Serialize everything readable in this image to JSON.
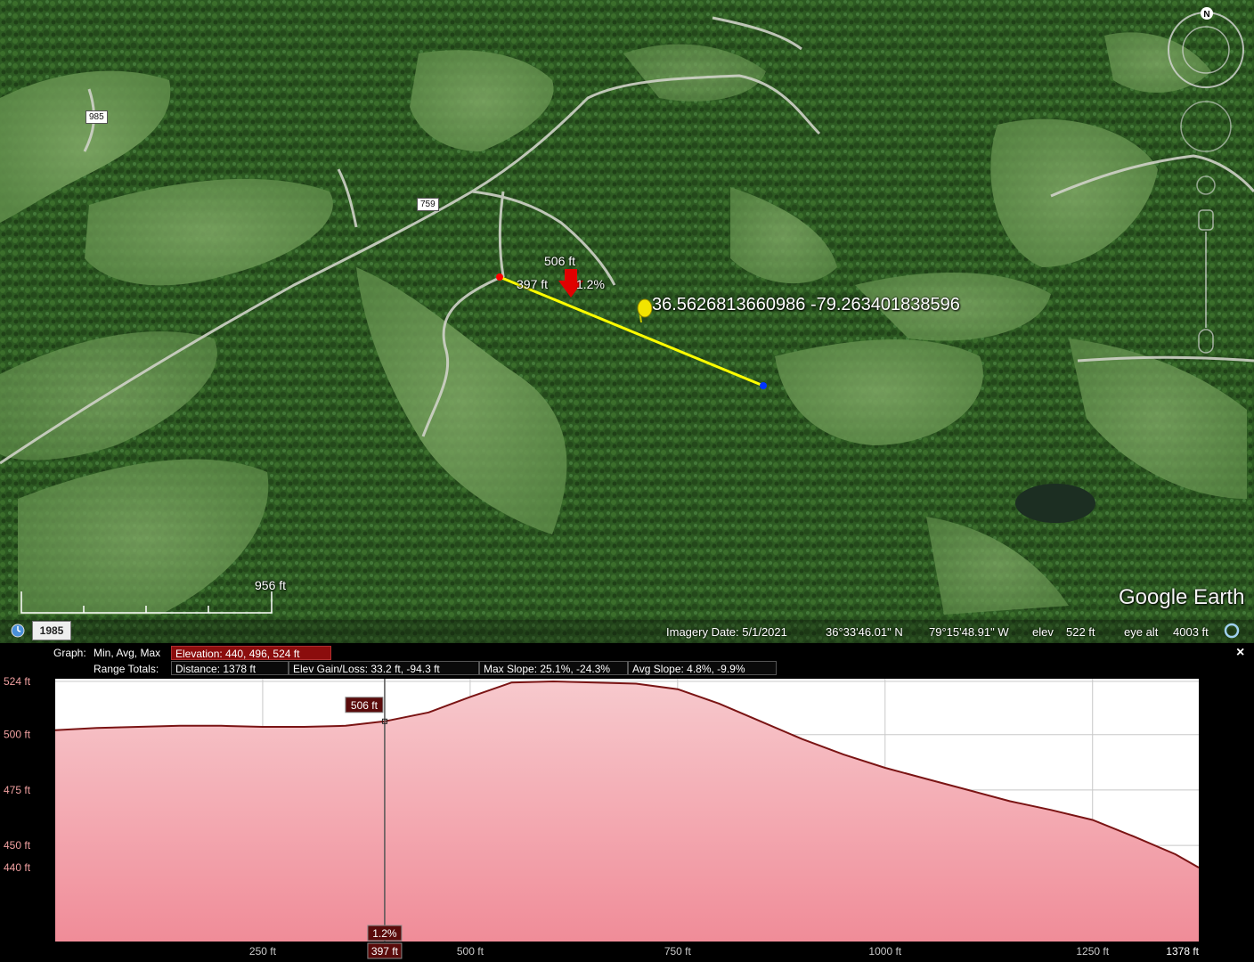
{
  "map": {
    "road_labels": [
      "985",
      "759"
    ],
    "scale_label": "956 ft",
    "point_elevation": "506 ft",
    "point_distance": "397 ft",
    "point_slope": "1.2%",
    "coordinate_label": "36.5626813660986 -79.263401838596",
    "logo": "Google Earth",
    "compass_label": "N",
    "icons": [
      "compass-icon",
      "look-joystick-icon",
      "move-joystick-icon",
      "zoom-slider-icon",
      "pushpin-icon",
      "history-clock-icon",
      "globe-icon"
    ],
    "path_color": "#ffff00",
    "marker_start_color": "#ff0000",
    "marker_end_color": "#0033ff"
  },
  "status": {
    "year": "1985",
    "imagery_date": "Imagery Date: 5/1/2021",
    "latitude": "36°33'46.01\" N",
    "longitude": "79°15'48.91\" W",
    "elev_label": "elev",
    "elev_value": "522 ft",
    "eye_alt_label": "eye alt",
    "eye_alt_value": "4003 ft"
  },
  "profile": {
    "graph_label": "Graph:",
    "graph_mode": "Min, Avg, Max",
    "elevation": "Elevation: 440, 496, 524 ft",
    "range_totals_label": "Range Totals:",
    "distance": "Distance: 1378 ft",
    "elev_gain_loss": "Elev Gain/Loss: 33.2 ft, -94.3 ft",
    "max_slope": "Max Slope: 25.1%, -24.3%",
    "avg_slope": "Avg Slope: 4.8%, -9.9%",
    "close_symbol": "×"
  },
  "chart_data": {
    "type": "area",
    "x": [
      0,
      50,
      100,
      150,
      200,
      250,
      300,
      350,
      397,
      450,
      500,
      550,
      600,
      650,
      700,
      750,
      800,
      850,
      900,
      950,
      1000,
      1050,
      1100,
      1150,
      1200,
      1250,
      1300,
      1350,
      1378
    ],
    "y": [
      502,
      503,
      503.5,
      504,
      504,
      503.5,
      503.5,
      504,
      506,
      510,
      517,
      523.5,
      524,
      523.5,
      523,
      520.5,
      514,
      506,
      498,
      491,
      485,
      480,
      475,
      470,
      466,
      461.5,
      454,
      446,
      440
    ],
    "xticks": [
      250,
      500,
      750,
      1000,
      1250
    ],
    "xtick_labels": [
      "250 ft",
      "500 ft",
      "750 ft",
      "1000 ft",
      "1250 ft"
    ],
    "x_end_label": "1378 ft",
    "yticks": [
      440,
      450,
      475,
      500,
      524
    ],
    "ytick_labels": [
      "440 ft",
      "450 ft",
      "475 ft",
      "500 ft",
      "524 ft"
    ],
    "xlim": [
      0,
      1378
    ],
    "ylim": [
      440,
      524
    ],
    "grid": true,
    "cursor": {
      "x": 397,
      "y": 506,
      "x_label": "397 ft",
      "y_label": "506 ft",
      "slope_label": "1.2%"
    },
    "line_color": "#7a1414",
    "fill_top_color": "#f7c9cd",
    "fill_bottom_color": "#f08c98"
  }
}
